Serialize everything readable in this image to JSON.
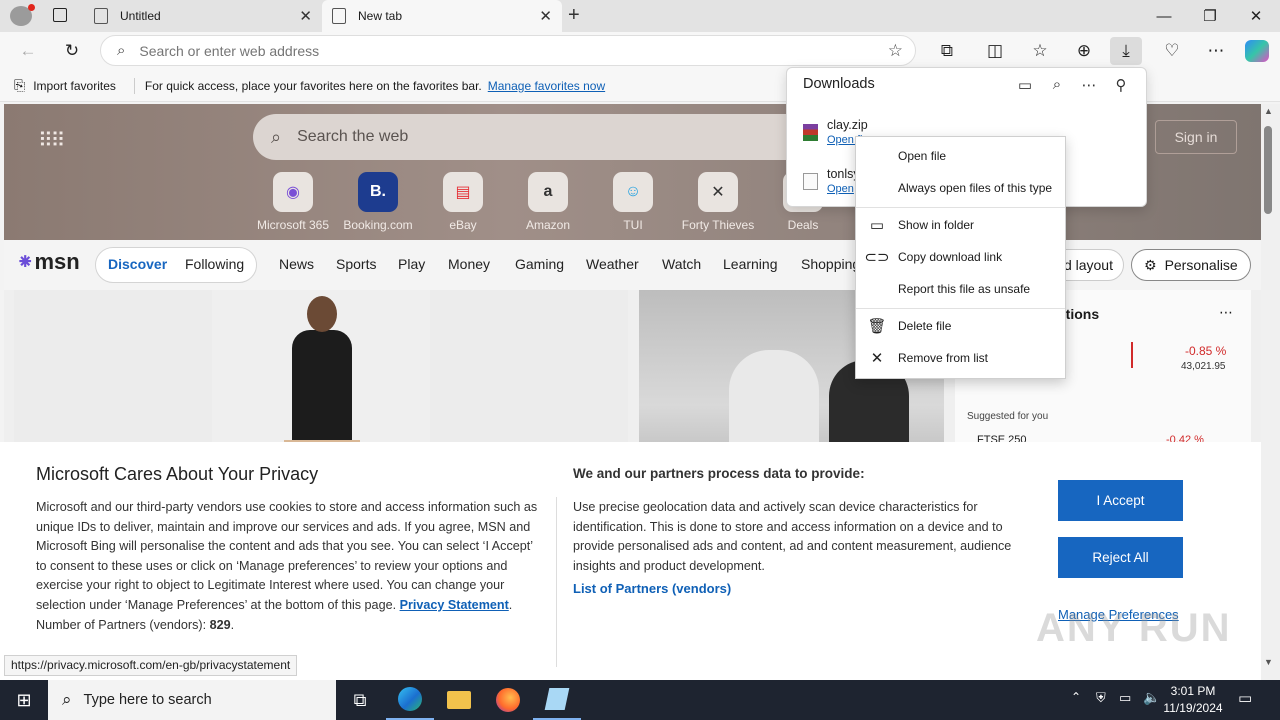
{
  "tabs": [
    {
      "title": "Untitled"
    },
    {
      "title": "New tab"
    }
  ],
  "address_bar": {
    "placeholder": "Search or enter web address"
  },
  "favorites_bar": {
    "import_label": "Import favorites",
    "hint": "For quick access, place your favorites here on the favorites bar.",
    "manage_link": "Manage favorites now"
  },
  "msn": {
    "search_placeholder": "Search the web",
    "sign_in": "Sign in",
    "logo": "msn",
    "quick_links": [
      "Microsoft 365",
      "Booking.com",
      "eBay",
      "Amazon",
      "TUI",
      "Forty Thieves",
      "Deals"
    ],
    "nav": [
      "Discover",
      "Following",
      "News",
      "Sports",
      "Play",
      "Money",
      "Gaming",
      "Weather",
      "Watch",
      "Learning",
      "Shopping"
    ],
    "layout_label": "d layout",
    "personalise_label": "Personalise",
    "suggestions_title": "ggestions",
    "stock_change": "-0.85 %",
    "stock_value": "43,021.95",
    "suggested_for_you": "Suggested for you",
    "stock2_name": "FTSE 250",
    "stock2_change": "-0.42 %"
  },
  "downloads": {
    "title": "Downloads",
    "items": [
      {
        "name": "clay.zip",
        "action": "Open fi"
      },
      {
        "name": "tonlsy",
        "action": "Open"
      }
    ]
  },
  "context_menu": {
    "items": [
      {
        "label": "Open file",
        "icon": "none"
      },
      {
        "label": "Always open files of this type",
        "icon": "none"
      },
      {
        "label": "Show in folder",
        "icon": "folder-icon"
      },
      {
        "label": "Copy download link",
        "icon": "link-icon"
      },
      {
        "label": "Report this file as unsafe",
        "icon": "none"
      },
      {
        "label": "Delete file",
        "icon": "trash-icon"
      },
      {
        "label": "Remove from list",
        "icon": "close-icon"
      }
    ]
  },
  "privacy": {
    "title": "Microsoft Cares About Your Privacy",
    "body": "Microsoft and our third-party vendors use cookies to store and access information such as unique IDs to deliver, maintain and improve our services and ads. If you agree, MSN and Microsoft Bing will personalise the content and ads that you see. You can select ‘I Accept’ to consent to these uses or click on ‘Manage preferences’ to review your options and exercise your right to object to Legitimate Interest where used.  You can change your selection under ‘Manage Preferences’ at the bottom of this page.",
    "statement_link": "Privacy Statement",
    "partners_label": "Number of Partners (vendors):",
    "partners_count": "829",
    "right_heading": "We and our partners process data to provide:",
    "right_body": "Use precise geolocation data and actively scan device characteristics for identification. This is done to store and access information on a device and to provide personalised ads and content, ad and content measurement, audience insights and product development.",
    "partners_link": "List of Partners (vendors)",
    "accept": "I Accept",
    "reject": "Reject All",
    "manage": "Manage Preferences"
  },
  "status_url": "https://privacy.microsoft.com/en-gb/privacystatement",
  "taskbar": {
    "search_placeholder": "Type here to search",
    "time": "3:01 PM",
    "date": "11/19/2024"
  },
  "watermark": "ANY RUN",
  "colors": {
    "accent": "#1766c0",
    "link": "#0f60b6",
    "taskbar": "#1e2430"
  }
}
